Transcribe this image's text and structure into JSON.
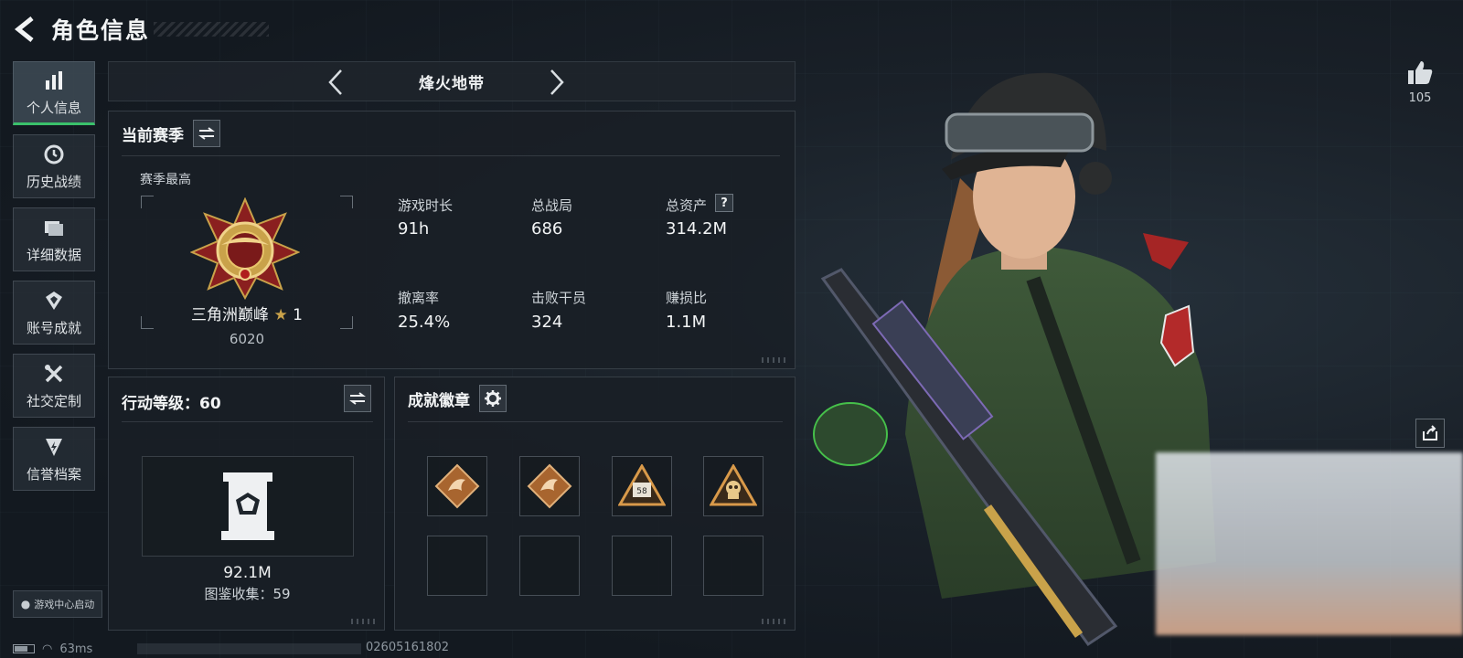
{
  "header": {
    "title": "角色信息"
  },
  "nav": {
    "items": [
      {
        "label": "个人信息",
        "icon": "bar-chart-icon",
        "active": true
      },
      {
        "label": "历史战绩",
        "icon": "history-icon",
        "active": false
      },
      {
        "label": "详细数据",
        "icon": "folder-icon",
        "active": false
      },
      {
        "label": "账号成就",
        "icon": "achievement-icon",
        "active": false
      },
      {
        "label": "社交定制",
        "icon": "tools-icon",
        "active": false
      },
      {
        "label": "信誉档案",
        "icon": "reputation-icon",
        "active": false
      }
    ],
    "launch_label": "游戏中心启动"
  },
  "mode": {
    "title": "烽火地带"
  },
  "season": {
    "title": "当前赛季",
    "best_label": "赛季最高",
    "rank_name": "三角洲巅峰",
    "rank_stars": "1",
    "rank_score": "6020",
    "stats": [
      {
        "label": "游戏时长",
        "value": "91h"
      },
      {
        "label": "总战局",
        "value": "686"
      },
      {
        "label": "总资产",
        "value": "314.2M",
        "help": "?"
      },
      {
        "label": "撤离率",
        "value": "25.4%"
      },
      {
        "label": "击败干员",
        "value": "324"
      },
      {
        "label": "赚损比",
        "value": "1.1M"
      }
    ]
  },
  "level": {
    "title": "行动等级：60",
    "collection_value": "92.1M",
    "collection_label": "图鉴收集：59"
  },
  "badges": {
    "title": "成就徽章",
    "items": [
      {
        "icon": "dragon-badge-icon"
      },
      {
        "icon": "dragon-badge-icon"
      },
      {
        "icon": "number-58-badge-icon",
        "text": "58"
      },
      {
        "icon": "skull-badge-icon"
      }
    ]
  },
  "social": {
    "likes": "105"
  },
  "footer": {
    "ping": "63ms",
    "uid": "02605161802"
  },
  "colors": {
    "accent_green": "#3ac16b",
    "gold": "#c9a24a",
    "badge_bronze": "#a8652f"
  }
}
